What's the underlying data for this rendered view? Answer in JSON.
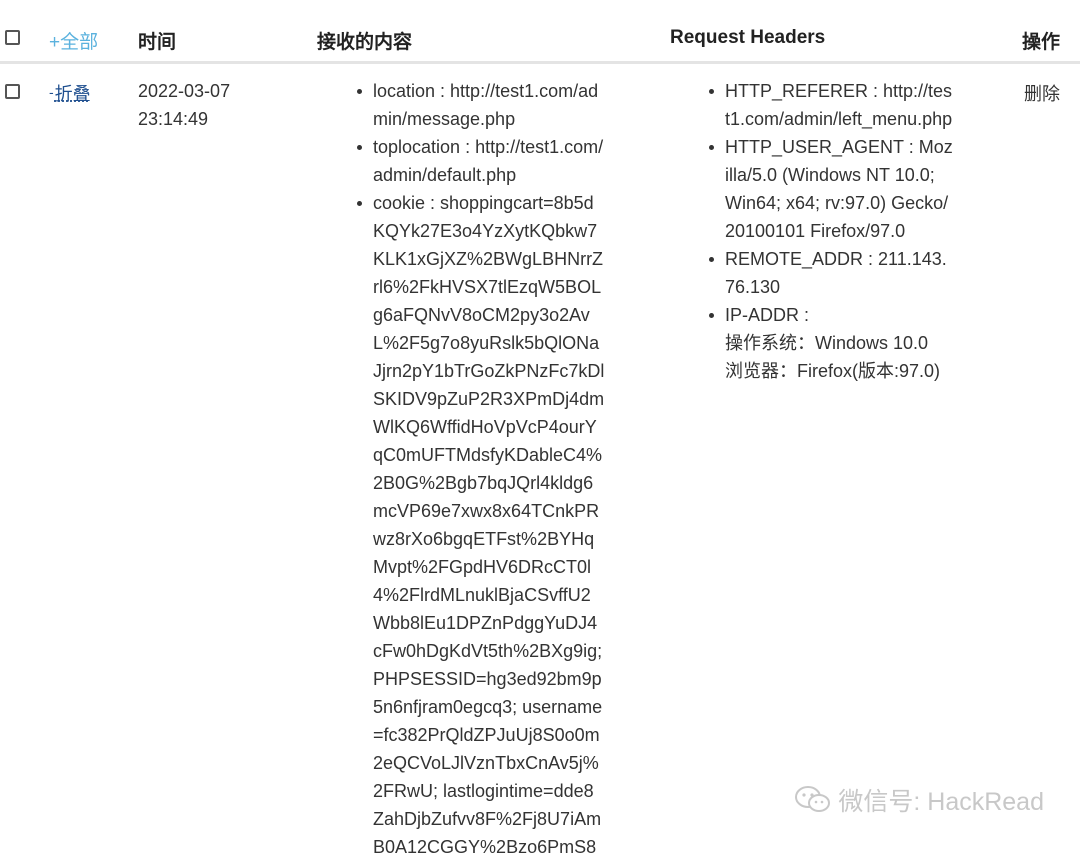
{
  "header": {
    "select_all_label": "+全部",
    "col_time": "时间",
    "col_content": "接收的内容",
    "col_headers": "Request Headers",
    "col_action": "操作"
  },
  "row": {
    "toggle_label": "折叠",
    "time_date": "2022-03-07",
    "time_clock": "23:14:49",
    "delete_label": "删除",
    "content_items": [
      [
        "location : http://test1.com/ad",
        "min/message.php"
      ],
      [
        "toplocation : http://test1.com/",
        "admin/default.php"
      ],
      [
        "cookie : shoppingcart=8b5d",
        "KQYk27E3o4YzXytKQbkw7",
        "KLK1xGjXZ%2BWgLBHNrrZ",
        "rl6%2FkHVSX7tlEzqW5BOL",
        "g6aFQNvV8oCM2py3o2Av",
        "L%2F5g7o8yuRslk5bQlONa",
        "Jjrn2pY1bTrGoZkPNzFc7kDl",
        "SKIDV9pZuP2R3XPmDj4dm",
        "WlKQ6WffidHoVpVcP4ourY",
        "qC0mUFTMdsfyKDableC4%",
        "2B0G%2Bgb7bqJQrl4kldg6",
        "mcVP69e7xwx8x64TCnkPR",
        "wz8rXo6bgqETFst%2BYHq",
        "Mvpt%2FGpdHV6DRcCT0l",
        "4%2FlrdMLnuklBjaCSvffU2",
        "Wbb8lEu1DPZnPdggYuDJ4",
        "cFw0hDgKdVt5th%2BXg9ig;",
        "PHPSESSID=hg3ed92bm9p",
        "5n6nfjram0egcq3; username",
        "=fc382PrQldZPJuUj8S0o0m",
        "2eQCVoLJlVznTbxCnAv5j%",
        "2FRwU; lastlogintime=dde8",
        "ZahDjbZufvv8F%2Fj8U7iAm",
        "B0A12CGGY%2Bzo6PmS8"
      ]
    ],
    "header_items": [
      [
        "HTTP_REFERER : http://tes",
        "t1.com/admin/left_menu.php"
      ],
      [
        "HTTP_USER_AGENT : Moz",
        "illa/5.0 (Windows NT 10.0;",
        "Win64; x64; rv:97.0) Gecko/",
        "20100101 Firefox/97.0"
      ],
      [
        "REMOTE_ADDR : 211.143.",
        "76.130"
      ],
      [
        "IP-ADDR :",
        "操作系统：Windows 10.0",
        "浏览器：Firefox(版本:97.0)"
      ]
    ]
  },
  "watermark": {
    "text": "微信号: HackRead",
    "icon": "wechat-icon"
  },
  "colors": {
    "link": "#5bb2de",
    "toggle": "#1f4f8f",
    "text": "#333333"
  }
}
